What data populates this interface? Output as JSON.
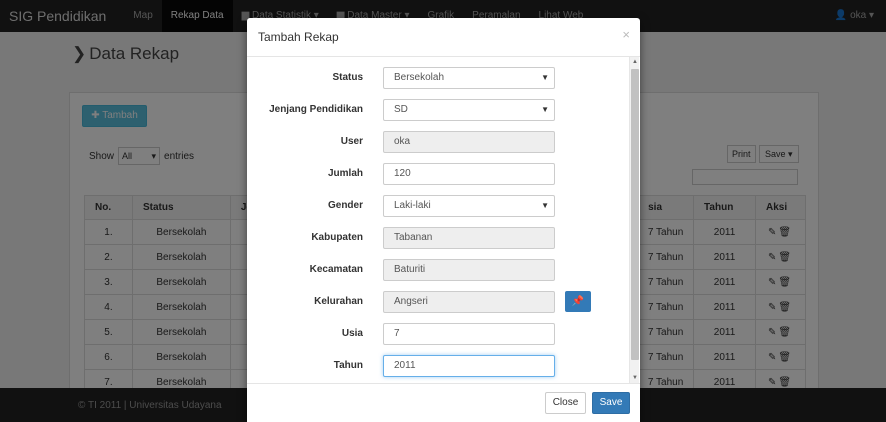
{
  "navbar": {
    "brand": "SIG Pendidikan",
    "items": [
      {
        "label": "Map"
      },
      {
        "label": "Rekap Data",
        "active": true
      },
      {
        "label": "▆ Data Statistik ▾"
      },
      {
        "label": "▆ Data Master ▾"
      },
      {
        "label": "Grafik"
      },
      {
        "label": "Peramalan"
      },
      {
        "label": "Lihat Web"
      }
    ],
    "user": "👤 oka ▾"
  },
  "page": {
    "title": "Data Rekap"
  },
  "panel": {
    "add_label": "✚ Tambah",
    "show_label": "Show",
    "show_value": "All",
    "entries_label": "entries",
    "print_label": "Print",
    "save_label": "Save ▾"
  },
  "table": {
    "headers": [
      "No.",
      "Status",
      "Je",
      "sia",
      "Tahun",
      "Aksi"
    ],
    "rows": [
      {
        "no": "1.",
        "status": "Bersekolah",
        "usia": "7 Tahun",
        "tahun": "2011"
      },
      {
        "no": "2.",
        "status": "Bersekolah",
        "usia": "7 Tahun",
        "tahun": "2011"
      },
      {
        "no": "3.",
        "status": "Bersekolah",
        "usia": "7 Tahun",
        "tahun": "2011"
      },
      {
        "no": "4.",
        "status": "Bersekolah",
        "usia": "7 Tahun",
        "tahun": "2011"
      },
      {
        "no": "5.",
        "status": "Bersekolah",
        "usia": "7 Tahun",
        "tahun": "2011"
      },
      {
        "no": "6.",
        "status": "Bersekolah",
        "usia": "7 Tahun",
        "tahun": "2011"
      },
      {
        "no": "7.",
        "status": "Bersekolah",
        "usia": "7 Tahun",
        "tahun": "2011"
      }
    ]
  },
  "footer": {
    "text": "© TI 2011 | Universitas Udayana"
  },
  "modal": {
    "title": "Tambah Rekap",
    "close_icon": "×",
    "fields": [
      {
        "label": "Status",
        "value": "Bersekolah",
        "type": "select"
      },
      {
        "label": "Jenjang Pendidikan",
        "value": "SD",
        "type": "select"
      },
      {
        "label": "User",
        "value": "oka",
        "type": "readonly"
      },
      {
        "label": "Jumlah",
        "value": "120",
        "type": "input"
      },
      {
        "label": "Gender",
        "value": "Laki-laki",
        "type": "select"
      },
      {
        "label": "Kabupaten",
        "value": "Tabanan",
        "type": "readonly"
      },
      {
        "label": "Kecamatan",
        "value": "Baturiti",
        "type": "readonly"
      },
      {
        "label": "Kelurahan",
        "value": "Angseri",
        "type": "readonly"
      },
      {
        "label": "Usia",
        "value": "7",
        "type": "input"
      },
      {
        "label": "Tahun",
        "value": "2011",
        "type": "input"
      }
    ],
    "close_label": "Close",
    "save_label": "Save"
  },
  "colors": {
    "primary": "#337ab7",
    "info": "#5bc0de",
    "navbar": "#222222"
  }
}
